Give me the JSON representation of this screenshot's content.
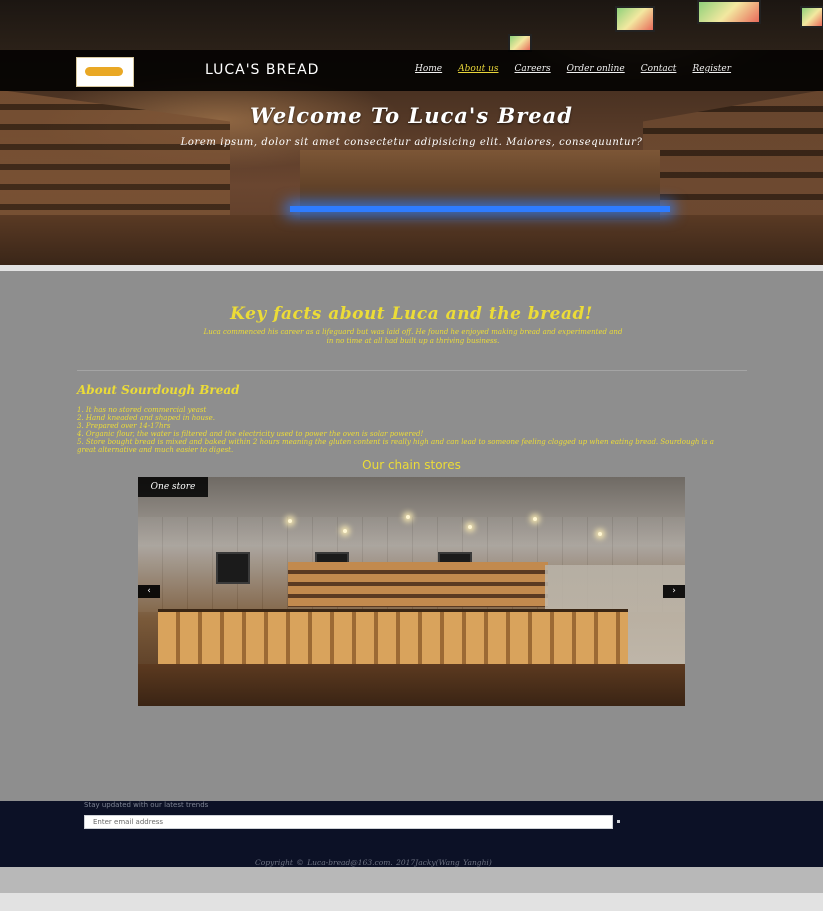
{
  "header": {
    "brand": "LUCA'S BREAD",
    "nav": [
      {
        "label": "Home",
        "active": false
      },
      {
        "label": "About us",
        "active": true
      },
      {
        "label": "Careers",
        "active": false
      },
      {
        "label": "Order online",
        "active": false
      },
      {
        "label": "Contact",
        "active": false
      },
      {
        "label": "Register",
        "active": false
      }
    ]
  },
  "hero": {
    "title": "Welcome To Luca's Bread",
    "subtitle": "Lorem ipsum, dolor sit amet consectetur adipisicing elit. Maiores, consequuntur?"
  },
  "facts": {
    "title": "Key facts about Luca and the bread!",
    "text": "Luca commenced his career as a lifeguard but was laid off. He found he enjoyed making bread and experimented and in no time at all had built up a thriving business."
  },
  "sourdough": {
    "title": "About Sourdough Bread",
    "items": [
      "1. It has no stored commercial yeast",
      "2. Hand kneaded and shaped in house.",
      "3. Prepared over 14-17hrs",
      "4. Organic flour, the water is filtered and the electricity used to power the oven is solar powered!",
      "5. Store bought bread is mixed and baked within 2 hours meaning the gluten content is really high and can lead to someone feeling clogged up when eating bread. Sourdough is a great alternative and much easier to digest."
    ]
  },
  "chain": {
    "title": "Our chain stores",
    "caption": "One store",
    "prev": "‹",
    "next": "›"
  },
  "footer": {
    "newsletter_label": "Stay updated with our latest trends",
    "email_placeholder": "Enter email address",
    "copyright": "Copyright © Luca-bread@163.com.        2017Jacky(Wang Yanghi)"
  },
  "colors": {
    "accent_yellow": "#ecdc37",
    "navbar": "#000000",
    "main_bg": "#8e8e8e",
    "footer_bg": "#0c1126"
  },
  "icons": {
    "logo": "luca-logo",
    "prev": "chevron-left-icon",
    "next": "chevron-right-icon"
  }
}
